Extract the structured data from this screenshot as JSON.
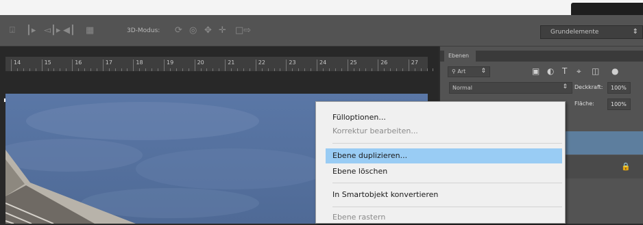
{
  "options_bar": {
    "mode_label": "3D-Modus:",
    "workspace": "Grundelemente",
    "icons": [
      "align-top-icon",
      "distribute-left-icon",
      "distribute-center-icon",
      "distribute-right-icon",
      "auto-align-icon",
      "rotate-3d-icon",
      "roll-3d-icon",
      "pan-3d-icon",
      "slide-3d-icon",
      "scale-3d-icon"
    ]
  },
  "ruler": {
    "labels": [
      "14",
      "15",
      "16",
      "17",
      "18",
      "19",
      "20",
      "21",
      "22",
      "23",
      "24",
      "25",
      "26",
      "27"
    ]
  },
  "layers_panel": {
    "tab_label": "Ebenen",
    "filter_kind": "Art",
    "blend_mode": "Normal",
    "opacity_label": "Deckkraft:",
    "opacity_value": "100%",
    "fill_label": "Fläche:",
    "fill_value": "100%"
  },
  "context_menu": {
    "items": [
      {
        "label": "Fülloptionen...",
        "enabled": true,
        "highlighted": false
      },
      {
        "label": "Korrektur bearbeiten...",
        "enabled": false,
        "highlighted": false
      },
      {
        "label": "Ebene duplizieren...",
        "enabled": true,
        "highlighted": true
      },
      {
        "label": "Ebene löschen",
        "enabled": true,
        "highlighted": false
      },
      {
        "label": "In Smartobjekt konvertieren",
        "enabled": true,
        "highlighted": false
      },
      {
        "label": "Ebene rastern",
        "enabled": false,
        "highlighted": false
      }
    ]
  },
  "colors": {
    "options_bar_bg": "#535353",
    "panel_bg": "#535353",
    "selected_layer": "#5d7e9e",
    "menu_highlight": "#99ccf4",
    "sky": "#54709c"
  }
}
